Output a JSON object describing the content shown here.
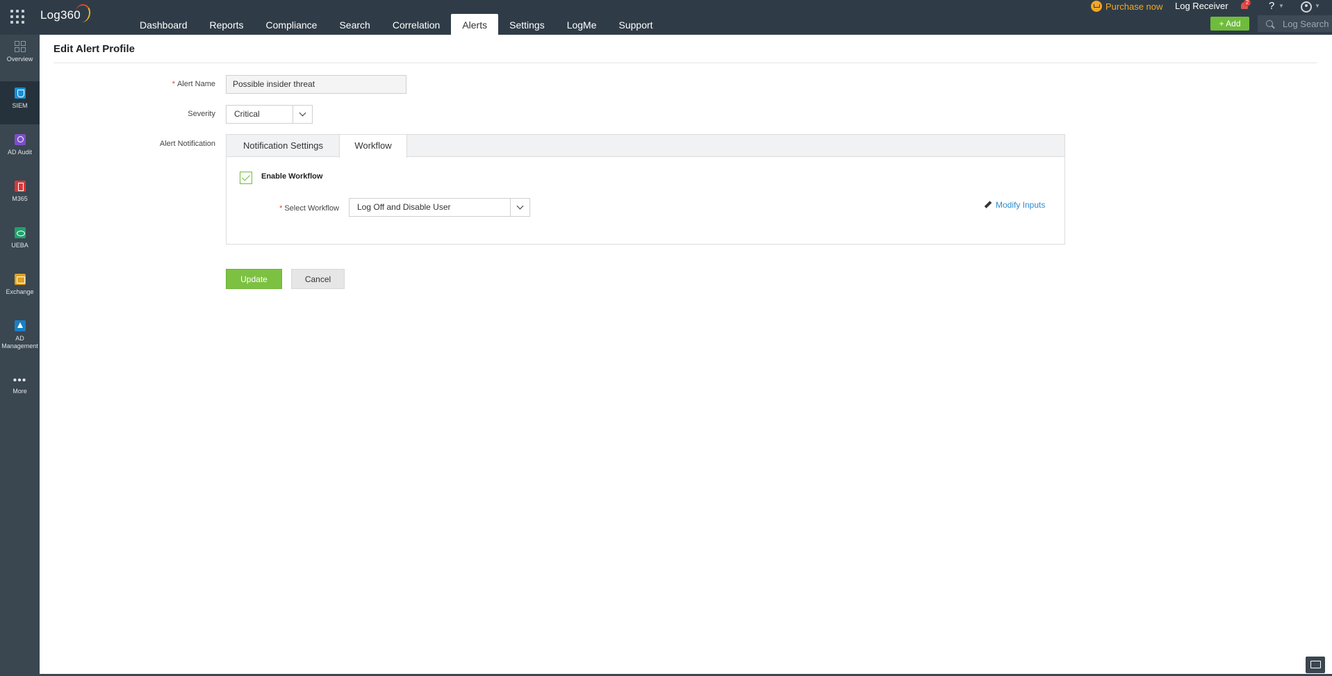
{
  "app": {
    "logo": "Log360"
  },
  "nav": {
    "items": [
      {
        "label": "Dashboard"
      },
      {
        "label": "Reports"
      },
      {
        "label": "Compliance"
      },
      {
        "label": "Search"
      },
      {
        "label": "Correlation"
      },
      {
        "label": "Alerts",
        "active": true
      },
      {
        "label": "Settings"
      },
      {
        "label": "LogMe"
      },
      {
        "label": "Support"
      }
    ]
  },
  "header_right": {
    "purchase_label": "Purchase now",
    "log_receiver_label": "Log Receiver",
    "notification_count": "2",
    "help_label": "?",
    "add_label": "Add",
    "log_search_label": "Log Search"
  },
  "sidebar": {
    "items": [
      {
        "label": "Overview",
        "icon": "overview-icon"
      },
      {
        "label": "SIEM",
        "icon": "siem-shield-icon",
        "active": true
      },
      {
        "label": "AD Audit",
        "icon": "ad-audit-icon"
      },
      {
        "label": "M365",
        "icon": "m365-icon"
      },
      {
        "label": "UEBA",
        "icon": "ueba-eye-icon"
      },
      {
        "label": "Exchange",
        "icon": "exchange-mail-icon"
      },
      {
        "label": "AD",
        "label2": "Management",
        "icon": "ad-management-icon"
      },
      {
        "label": "More",
        "icon": "more-dots-icon"
      }
    ]
  },
  "page": {
    "title": "Edit Alert Profile"
  },
  "form": {
    "alert_name_label": "Alert Name",
    "alert_name_value": "Possible insider threat",
    "severity_label": "Severity",
    "severity_value": "Critical",
    "alert_notification_label": "Alert Notification",
    "tabs": [
      {
        "label": "Notification Settings"
      },
      {
        "label": "Workflow",
        "active": true
      }
    ],
    "enable_workflow_label": "Enable Workflow",
    "enable_workflow_checked": true,
    "select_workflow_label": "Select Workflow",
    "select_workflow_value": "Log Off and Disable User",
    "modify_inputs_label": "Modify Inputs",
    "required_mark": "*"
  },
  "actions": {
    "update_label": "Update",
    "cancel_label": "Cancel"
  },
  "colors": {
    "topbar": "#2f3c47",
    "sidebar": "#3a4650",
    "accent_green": "#7cc142",
    "link_blue": "#2a8bd0",
    "purchase_orange": "#f5a623"
  }
}
